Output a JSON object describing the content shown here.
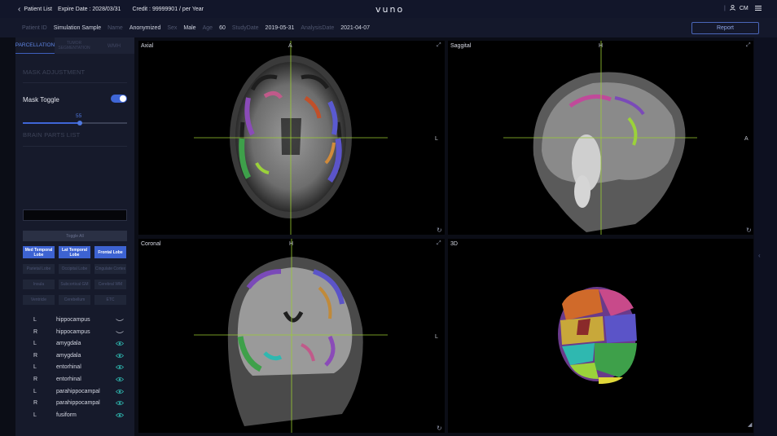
{
  "header": {
    "back_label": "Patient List",
    "expire": "Expire Date : 2028/03/31",
    "credit": "Credit : 99999901 / per Year",
    "logo": "vuno",
    "divider": "|",
    "user": "CM"
  },
  "info": {
    "patient_id_label": "Patient ID",
    "patient_id": "Simulation Sample",
    "name_label": "Name",
    "name": "Anonymized",
    "sex_label": "Sex",
    "sex": "Male",
    "age_label": "Age",
    "age": "60",
    "study_label": "StudyDate",
    "study": "2019-05-31",
    "analysis_label": "AnalysisDate",
    "analysis": "2021-04-07",
    "report_button": "Report"
  },
  "sidebar": {
    "tabs": [
      "PARCELLATION",
      "TUMOR SEGMENTATION",
      "WMH"
    ],
    "mask_adjustment": "MASK ADJUSTMENT",
    "mask_toggle": "Mask Toggle",
    "mask_toggle_on": true,
    "slider_value": "55",
    "slider_fraction": 0.55,
    "brain_parts_list": "BRAIN PARTS LIST",
    "toggle_all": "Toggle All",
    "grid_buttons": [
      {
        "label": "Med Temporal Lobe",
        "active": true
      },
      {
        "label": "Lat Temporal Lobe",
        "active": true
      },
      {
        "label": "Frontal Lobe",
        "active": true
      },
      {
        "label": "Parietal Lobe",
        "active": false
      },
      {
        "label": "Occipital Lobe",
        "active": false
      },
      {
        "label": "Cingulate Cortex",
        "active": false
      },
      {
        "label": "Insula",
        "active": false
      },
      {
        "label": "Subcortical GM",
        "active": false
      },
      {
        "label": "Cerebral WM",
        "active": false
      },
      {
        "label": "Ventricle",
        "active": false
      },
      {
        "label": "Cerebellum",
        "active": false
      },
      {
        "label": "ETC",
        "active": false
      }
    ],
    "parts": [
      {
        "side": "L",
        "name": "hippocampus",
        "visible": false
      },
      {
        "side": "R",
        "name": "hippocampus",
        "visible": false
      },
      {
        "side": "L",
        "name": "amygdala",
        "visible": true
      },
      {
        "side": "R",
        "name": "amygdala",
        "visible": true
      },
      {
        "side": "L",
        "name": "entorhinal",
        "visible": true
      },
      {
        "side": "R",
        "name": "entorhinal",
        "visible": true
      },
      {
        "side": "L",
        "name": "parahippocampal",
        "visible": true
      },
      {
        "side": "R",
        "name": "parahippocampal",
        "visible": true
      },
      {
        "side": "L",
        "name": "fusiform",
        "visible": true
      }
    ]
  },
  "viewports": {
    "axial": {
      "label": "Axial",
      "top": "A",
      "right": "L"
    },
    "sagittal": {
      "label": "Saggital",
      "top": "H",
      "right": "A"
    },
    "coronal": {
      "label": "Coronal",
      "top": "H",
      "right": "L"
    },
    "three_d": {
      "label": "3D"
    }
  },
  "colors": {
    "accent": "#3d63d2",
    "crosshair": "#9acd32",
    "eye_on": "#2fb8b0"
  },
  "icons": {
    "back": "chevron-left-icon",
    "user": "user-icon",
    "menu": "menu-icon",
    "expand": "expand-icon",
    "reset": "rotate-icon",
    "eye": "eye-icon",
    "eye_closed": "eye-closed-icon"
  }
}
